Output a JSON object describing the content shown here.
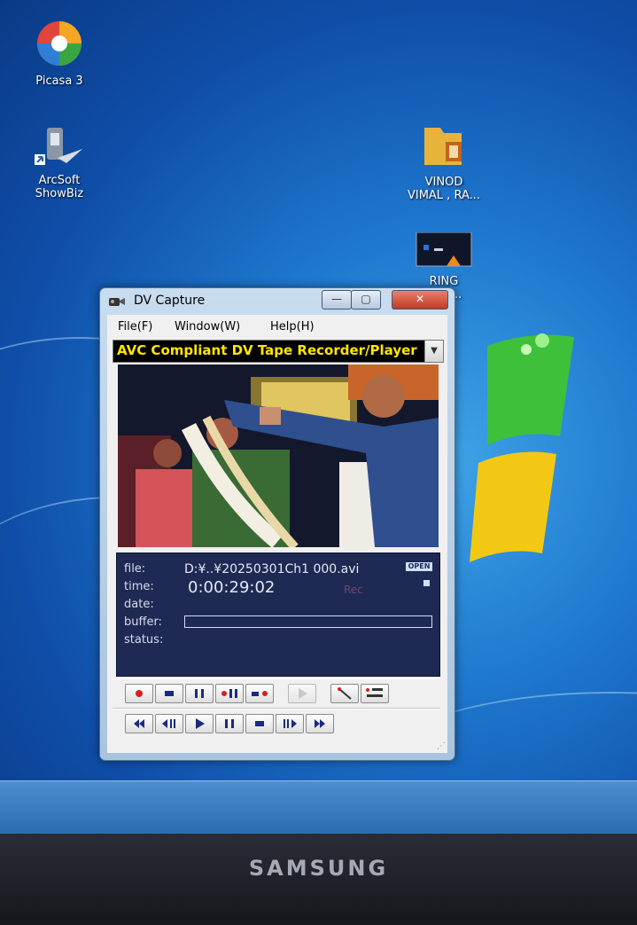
{
  "desktop": {
    "icons": [
      {
        "label_line1": "Picasa 3",
        "label_line2": ""
      },
      {
        "label_line1": "ArcSoft",
        "label_line2": "ShowBiz"
      },
      {
        "label_line1": "VINOD",
        "label_line2": "VIMAL , RA..."
      },
      {
        "label_line1": "RING",
        "label_line2": "..ON..."
      }
    ],
    "monitor_brand": "SAMSUNG"
  },
  "window": {
    "title": "DV Capture",
    "controls": {
      "minimize": "—",
      "maximize": "▢",
      "close": "✕"
    },
    "menu": [
      "File(F)",
      "Window(W)",
      "Help(H)"
    ],
    "device": {
      "label": "AVC Compliant DV Tape Recorder/Player"
    },
    "info": {
      "file_label": "file:",
      "file_value": "D:¥..¥20250301Ch1 000.avi",
      "open_badge": "OPEN",
      "time_label": "time:",
      "time_value": "0:00:29:02",
      "rec_label": "Rec",
      "date_label": "date:",
      "buffer_label": "buffer:",
      "status_label": "status:"
    },
    "record_toolbar": [
      {
        "name": "record-button",
        "icon": "record-icon"
      },
      {
        "name": "stop-record-button",
        "icon": "stop-icon"
      },
      {
        "name": "pause-record-button",
        "icon": "pause-icon"
      },
      {
        "name": "record-pause-button",
        "icon": "record-pause-icon"
      },
      {
        "name": "stop-record-dot-button",
        "icon": "stop-record-icon"
      },
      {
        "name": "play-disabled-button",
        "icon": "play-icon"
      },
      {
        "name": "settings-button",
        "icon": "tool-icon"
      },
      {
        "name": "timecode-button",
        "icon": "timecode-icon"
      }
    ],
    "playback_toolbar": [
      {
        "name": "rewind-button",
        "icon": "rewind-icon"
      },
      {
        "name": "step-back-button",
        "icon": "step-back-icon"
      },
      {
        "name": "play-button",
        "icon": "play-icon"
      },
      {
        "name": "pause-button",
        "icon": "pause-icon"
      },
      {
        "name": "stop-button",
        "icon": "stop-icon"
      },
      {
        "name": "step-forward-button",
        "icon": "step-forward-icon"
      },
      {
        "name": "fast-forward-button",
        "icon": "fast-forward-icon"
      }
    ]
  },
  "colors": {
    "device_label": "#ffe600",
    "info_panel": "#1e2a54",
    "close_button": "#c23b22"
  }
}
